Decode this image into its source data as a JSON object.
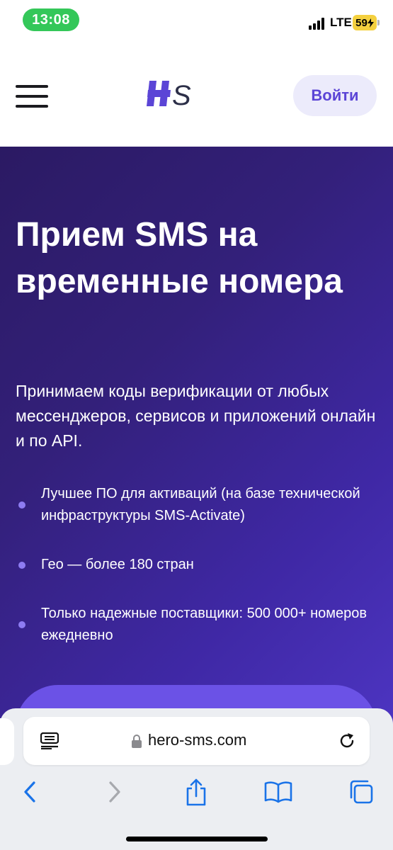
{
  "status_bar": {
    "time": "13:08",
    "network": "LTE",
    "battery": "59",
    "time_pill_color": "#34c759",
    "battery_color": "#f4d03f"
  },
  "header": {
    "logo_icon": "hero-sms-logo-icon",
    "menu_icon": "hamburger-menu-icon",
    "login_label": "Войти",
    "accent_color": "#5b45d6"
  },
  "hero": {
    "title": "Прием SMS на временные номера",
    "subtitle": "Принимаем коды верификации от любых мессенджеров, сервисов и приложений онлайн и по API.",
    "features": [
      "Лучшее ПО для активаций (на базе технической инфраструктуры SMS-Activate)",
      "Гео — более 180 стран",
      "Только надежные поставщики: 500 000+ номеров ежедневно"
    ],
    "gradient_start": "#2b1a63",
    "gradient_end": "#4e36c4"
  },
  "browser": {
    "url": "hero-sms.com",
    "icons": [
      "reader-icon",
      "lock-icon",
      "reload-icon",
      "back-icon",
      "forward-icon",
      "share-icon",
      "bookmarks-icon",
      "tabs-icon"
    ]
  }
}
